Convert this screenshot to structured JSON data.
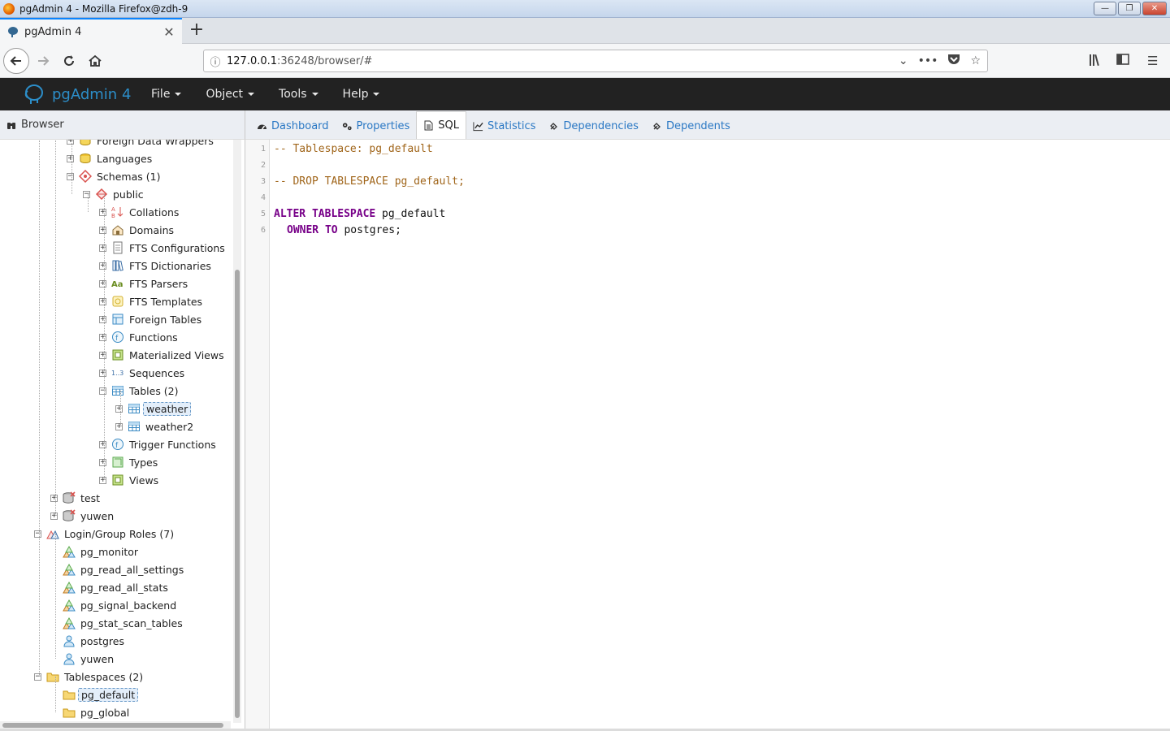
{
  "window": {
    "title": "pgAdmin 4 - Mozilla Firefox@zdh-9"
  },
  "browser_tab": {
    "title": "pgAdmin 4"
  },
  "address": {
    "host": "127.0.0.1",
    "rest": ":36248/browser/#"
  },
  "app": {
    "brand": "pgAdmin 4",
    "menus": [
      "File",
      "Object",
      "Tools",
      "Help"
    ]
  },
  "browser_panel": {
    "title": "Browser"
  },
  "tree": [
    {
      "label": "Foreign Data Wrappers",
      "icon": "fdw-icon",
      "toggle": "+",
      "depth": 3
    },
    {
      "label": "Languages",
      "icon": "language-icon",
      "toggle": "+",
      "depth": 3
    },
    {
      "label": "Schemas (1)",
      "icon": "schema-icon",
      "toggle": "-",
      "depth": 3
    },
    {
      "label": "public",
      "icon": "public-schema-icon",
      "toggle": "-",
      "depth": 4
    },
    {
      "label": "Collations",
      "icon": "collation-icon",
      "toggle": "+",
      "depth": 5
    },
    {
      "label": "Domains",
      "icon": "domain-icon",
      "toggle": "+",
      "depth": 5
    },
    {
      "label": "FTS Configurations",
      "icon": "fts-config-icon",
      "toggle": "+",
      "depth": 5
    },
    {
      "label": "FTS Dictionaries",
      "icon": "fts-dict-icon",
      "toggle": "+",
      "depth": 5
    },
    {
      "label": "FTS Parsers",
      "icon": "fts-parser-icon",
      "toggle": "+",
      "depth": 5
    },
    {
      "label": "FTS Templates",
      "icon": "fts-template-icon",
      "toggle": "+",
      "depth": 5
    },
    {
      "label": "Foreign Tables",
      "icon": "foreign-table-icon",
      "toggle": "+",
      "depth": 5
    },
    {
      "label": "Functions",
      "icon": "function-icon",
      "toggle": "+",
      "depth": 5
    },
    {
      "label": "Materialized Views",
      "icon": "mview-icon",
      "toggle": "+",
      "depth": 5
    },
    {
      "label": "Sequences",
      "icon": "sequence-icon",
      "toggle": "+",
      "depth": 5
    },
    {
      "label": "Tables (2)",
      "icon": "tables-icon",
      "toggle": "-",
      "depth": 5
    },
    {
      "label": "weather",
      "icon": "table-icon",
      "toggle": "+",
      "depth": 6,
      "selected": true
    },
    {
      "label": "weather2",
      "icon": "table-icon",
      "toggle": "+",
      "depth": 6
    },
    {
      "label": "Trigger Functions",
      "icon": "trigger-function-icon",
      "toggle": "+",
      "depth": 5
    },
    {
      "label": "Types",
      "icon": "type-icon",
      "toggle": "+",
      "depth": 5
    },
    {
      "label": "Views",
      "icon": "view-icon",
      "toggle": "+",
      "depth": 5
    },
    {
      "label": "test",
      "icon": "database-icon",
      "toggle": "+",
      "depth": 2
    },
    {
      "label": "yuwen",
      "icon": "database-icon",
      "toggle": "+",
      "depth": 2
    },
    {
      "label": "Login/Group Roles (7)",
      "icon": "roles-icon",
      "toggle": "-",
      "depth": 1
    },
    {
      "label": "pg_monitor",
      "icon": "group-role-icon",
      "toggle": "",
      "depth": 2
    },
    {
      "label": "pg_read_all_settings",
      "icon": "group-role-icon",
      "toggle": "",
      "depth": 2
    },
    {
      "label": "pg_read_all_stats",
      "icon": "group-role-icon",
      "toggle": "",
      "depth": 2
    },
    {
      "label": "pg_signal_backend",
      "icon": "group-role-icon",
      "toggle": "",
      "depth": 2
    },
    {
      "label": "pg_stat_scan_tables",
      "icon": "group-role-icon",
      "toggle": "",
      "depth": 2
    },
    {
      "label": "postgres",
      "icon": "user-role-icon",
      "toggle": "",
      "depth": 2
    },
    {
      "label": "yuwen",
      "icon": "user-role-icon",
      "toggle": "",
      "depth": 2
    },
    {
      "label": "Tablespaces (2)",
      "icon": "tablespaces-icon",
      "toggle": "-",
      "depth": 1
    },
    {
      "label": "pg_default",
      "icon": "tablespace-icon",
      "toggle": "",
      "depth": 2,
      "selected": true
    },
    {
      "label": "pg_global",
      "icon": "tablespace-icon",
      "toggle": "",
      "depth": 2
    }
  ],
  "panel_tabs": [
    {
      "label": "Dashboard",
      "icon": "dashboard-icon"
    },
    {
      "label": "Properties",
      "icon": "properties-icon"
    },
    {
      "label": "SQL",
      "icon": "sql-file-icon",
      "active": true
    },
    {
      "label": "Statistics",
      "icon": "statistics-icon"
    },
    {
      "label": "Dependencies",
      "icon": "dependencies-icon"
    },
    {
      "label": "Dependents",
      "icon": "dependents-icon"
    }
  ],
  "sql": {
    "line_numbers": [
      "1",
      "2",
      "3",
      "4",
      "5",
      "6"
    ],
    "line1": "-- Tablespace: pg_default",
    "line3": "-- DROP TABLESPACE pg_default;",
    "line5_kw": "ALTER TABLESPACE",
    "line5_rest": " pg_default",
    "line6_kw": "OWNER TO",
    "line6_rest": " postgres;"
  }
}
